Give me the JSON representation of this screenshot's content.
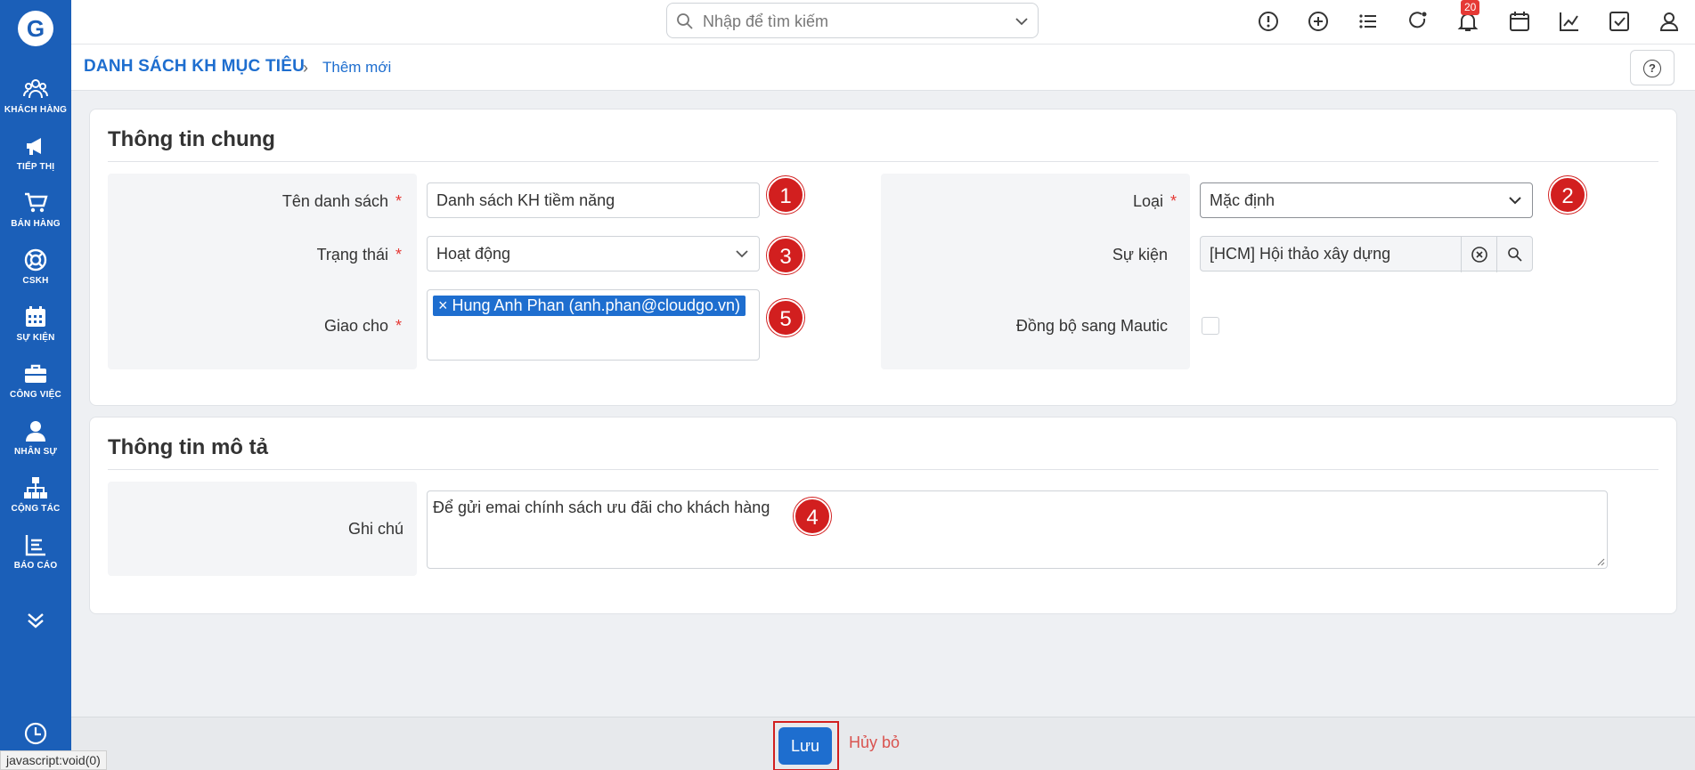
{
  "header": {
    "search_placeholder": "Nhập để tìm kiếm",
    "notification_count": "20",
    "icons": [
      "alert-circle-icon",
      "plus-circle-icon",
      "list-icon",
      "refresh-icon",
      "bell-icon",
      "calendar-icon",
      "chart-icon",
      "checkbox-icon",
      "user-icon"
    ]
  },
  "sidebar": {
    "logo_letter": "G",
    "items": [
      {
        "label": "KHÁCH HÀNG",
        "icon": "users-icon"
      },
      {
        "label": "TIẾP THỊ",
        "icon": "megaphone-icon"
      },
      {
        "label": "BÁN HÀNG",
        "icon": "cart-icon"
      },
      {
        "label": "CSKH",
        "icon": "lifebuoy-icon"
      },
      {
        "label": "SỰ KIỆN",
        "icon": "calendar-icon"
      },
      {
        "label": "CÔNG VIỆC",
        "icon": "briefcase-icon"
      },
      {
        "label": "NHÂN SỰ",
        "icon": "person-icon"
      },
      {
        "label": "CỘNG TÁC",
        "icon": "org-chart-icon"
      },
      {
        "label": "BÁO CÁO",
        "icon": "report-icon"
      }
    ]
  },
  "breadcrumb": {
    "main": "DANH SÁCH KH MỤC TIÊU",
    "separator": "›",
    "current": "Thêm mới",
    "help": "?"
  },
  "general": {
    "title": "Thông tin chung",
    "list_name": {
      "label": "Tên danh sách",
      "value": "Danh sách KH tiềm năng",
      "marker": "1"
    },
    "type": {
      "label": "Loại",
      "value": "Mặc định",
      "marker": "2"
    },
    "status": {
      "label": "Trạng thái",
      "value": "Hoạt động",
      "marker": "3"
    },
    "event": {
      "label": "Sự kiện",
      "value": "[HCM] Hội thảo xây dựng"
    },
    "assigned": {
      "label": "Giao cho",
      "value": "× Hung Anh Phan (anh.phan@cloudgo.vn)",
      "marker": "5"
    },
    "sync": {
      "label": "Đồng bộ sang Mautic",
      "checked": false
    },
    "required_mark": "*"
  },
  "description": {
    "title": "Thông tin mô tả",
    "note": {
      "label": "Ghi chú",
      "value": "Để gửi emai chính sách ưu đãi cho khách hàng",
      "marker": "4"
    }
  },
  "actions": {
    "save": "Lưu",
    "cancel": "Hủy bỏ"
  },
  "status_bar": "javascript:void(0)",
  "colors": {
    "sidebar": "#1b5fb8",
    "accent": "#1e6ecf",
    "marker": "#d21f1f",
    "cancel": "#d9534f"
  }
}
